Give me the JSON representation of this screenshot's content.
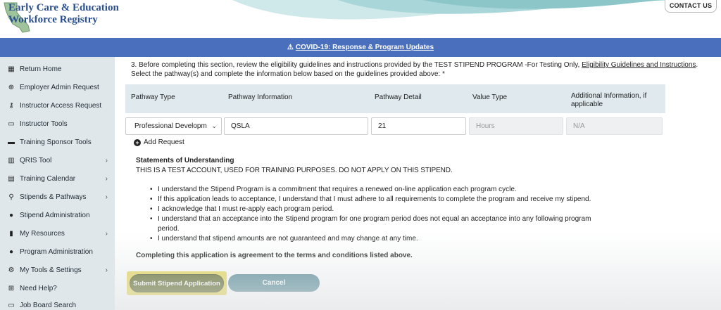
{
  "header": {
    "logo_line1": "Early Care & Education",
    "logo_line2": "Workforce Registry",
    "contact_label": "CONTACT US"
  },
  "banner": {
    "link_text": "COVID-19: Response & Program Updates"
  },
  "sidebar": {
    "items": [
      {
        "label": "Return Home",
        "icon": "grid-icon"
      },
      {
        "label": "Employer Admin Request",
        "icon": "globe-icon"
      },
      {
        "label": "Instructor Access Request",
        "icon": "key-icon"
      },
      {
        "label": "Instructor Tools",
        "icon": "toolbox-icon"
      },
      {
        "label": "Training Sponsor Tools",
        "icon": "projector-icon"
      },
      {
        "label": "QRIS Tool",
        "icon": "building-icon"
      },
      {
        "label": "Training Calendar",
        "icon": "calendar-icon"
      },
      {
        "label": "Stipends & Pathways",
        "icon": "search-icon"
      },
      {
        "label": "Stipend Administration",
        "icon": "user-icon"
      },
      {
        "label": "My Resources",
        "icon": "file-icon"
      },
      {
        "label": "Program Administration",
        "icon": "user-icon"
      },
      {
        "label": "My Tools & Settings",
        "icon": "gears-icon"
      },
      {
        "label": "Need Help?",
        "icon": "plus-square-icon"
      },
      {
        "label": "Job Board Search",
        "icon": "board-icon"
      }
    ]
  },
  "form": {
    "intro_part1": "3. Before completing this section, review the eligibility guidelines and instructions provided by the TEST STIPEND PROGRAM -For Testing Only,",
    "intro_link": "Eligibility Guidelines and Instructions",
    "intro_end": ".",
    "intro_line2": "Select the pathway(s) and complete the information below based on the guidelines provided above: *",
    "columns": [
      "Pathway Type",
      "Pathway Information",
      "Pathway Detail",
      "Value Type",
      "Additional Information, if applicable"
    ],
    "row": {
      "pathway_type": "Professional Developm",
      "pathway_information": "QSLA",
      "pathway_detail": "21",
      "value_type": "Hours",
      "additional_info": "N/A"
    },
    "add_request_label": "Add Request",
    "sou_title": "Statements of Understanding",
    "sou_note": "THIS IS A TEST ACCOUNT, USED FOR TRAINING PURPOSES. DO NOT APPLY ON THIS STIPEND.",
    "statements": [
      "I understand the Stipend Program is a commitment that requires a renewed on-line application each program cycle.",
      "If this application leads to acceptance, I understand that I must adhere to all requirements to complete the program and receive my stipend.",
      "I acknowledge that I must re-apply each program period.",
      "I understand that an acceptance into the Stipend program for one program period does not equal an acceptance into any following program period.",
      "I understand that stipend amounts are not guaranteed and may change at any time."
    ],
    "agreement_text": "Completing this application is agreement to the terms and conditions listed above.",
    "submit_label": "Submit Stipend Application",
    "cancel_label": "Cancel"
  },
  "colors": {
    "banner": "#4a6fbd",
    "sidebar": "#dfe7ea",
    "table_header": "#dfe9ee",
    "submit": "#5f6a2a",
    "submit_highlight": "#e7d95a",
    "cancel": "#5b8e9a",
    "logo_text": "#2a4f8f"
  }
}
